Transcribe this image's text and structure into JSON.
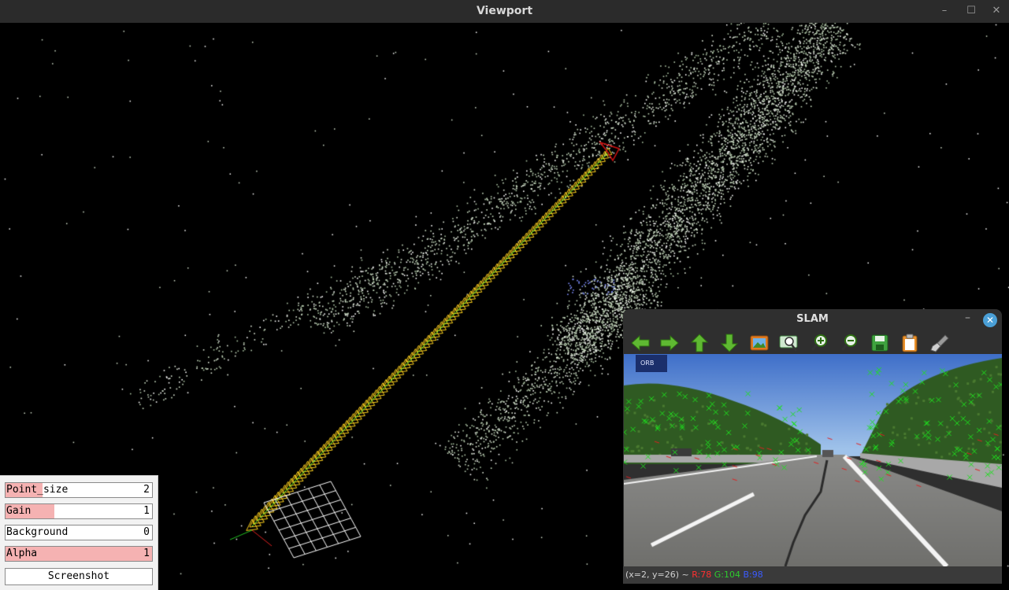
{
  "window": {
    "title": "Viewport",
    "minimize": "–",
    "maximize": "☐",
    "close": "✕"
  },
  "panel": {
    "vars": [
      {
        "label": "Point_size",
        "value": "2",
        "fill": 0.25
      },
      {
        "label": "Gain",
        "value": "1",
        "fill": 0.33
      },
      {
        "label": "Background",
        "value": "0",
        "fill": 0.0
      },
      {
        "label": "Alpha",
        "value": "1",
        "fill": 1.0
      }
    ],
    "screenshot_label": "Screenshot"
  },
  "slam": {
    "title": "SLAM",
    "minimize": "–",
    "close": "✕",
    "orb_label": "ORB",
    "toolbar": [
      "arrow-left-icon",
      "arrow-right-icon",
      "arrow-up-icon",
      "arrow-down-icon",
      "image-icon",
      "zoom-fit-icon",
      "zoom-in-icon",
      "zoom-out-icon",
      "save-icon",
      "clipboard-icon",
      "brush-icon"
    ],
    "status": {
      "coords": "(x=2, y=26) ~",
      "r": "R:78",
      "g": "G:104",
      "b": "B:98"
    }
  },
  "colors": {
    "trajectory": "#ffd21e",
    "current_camera": "#d01010",
    "points": "#c8dcc0",
    "panel_fill": "#f5b2b2"
  }
}
